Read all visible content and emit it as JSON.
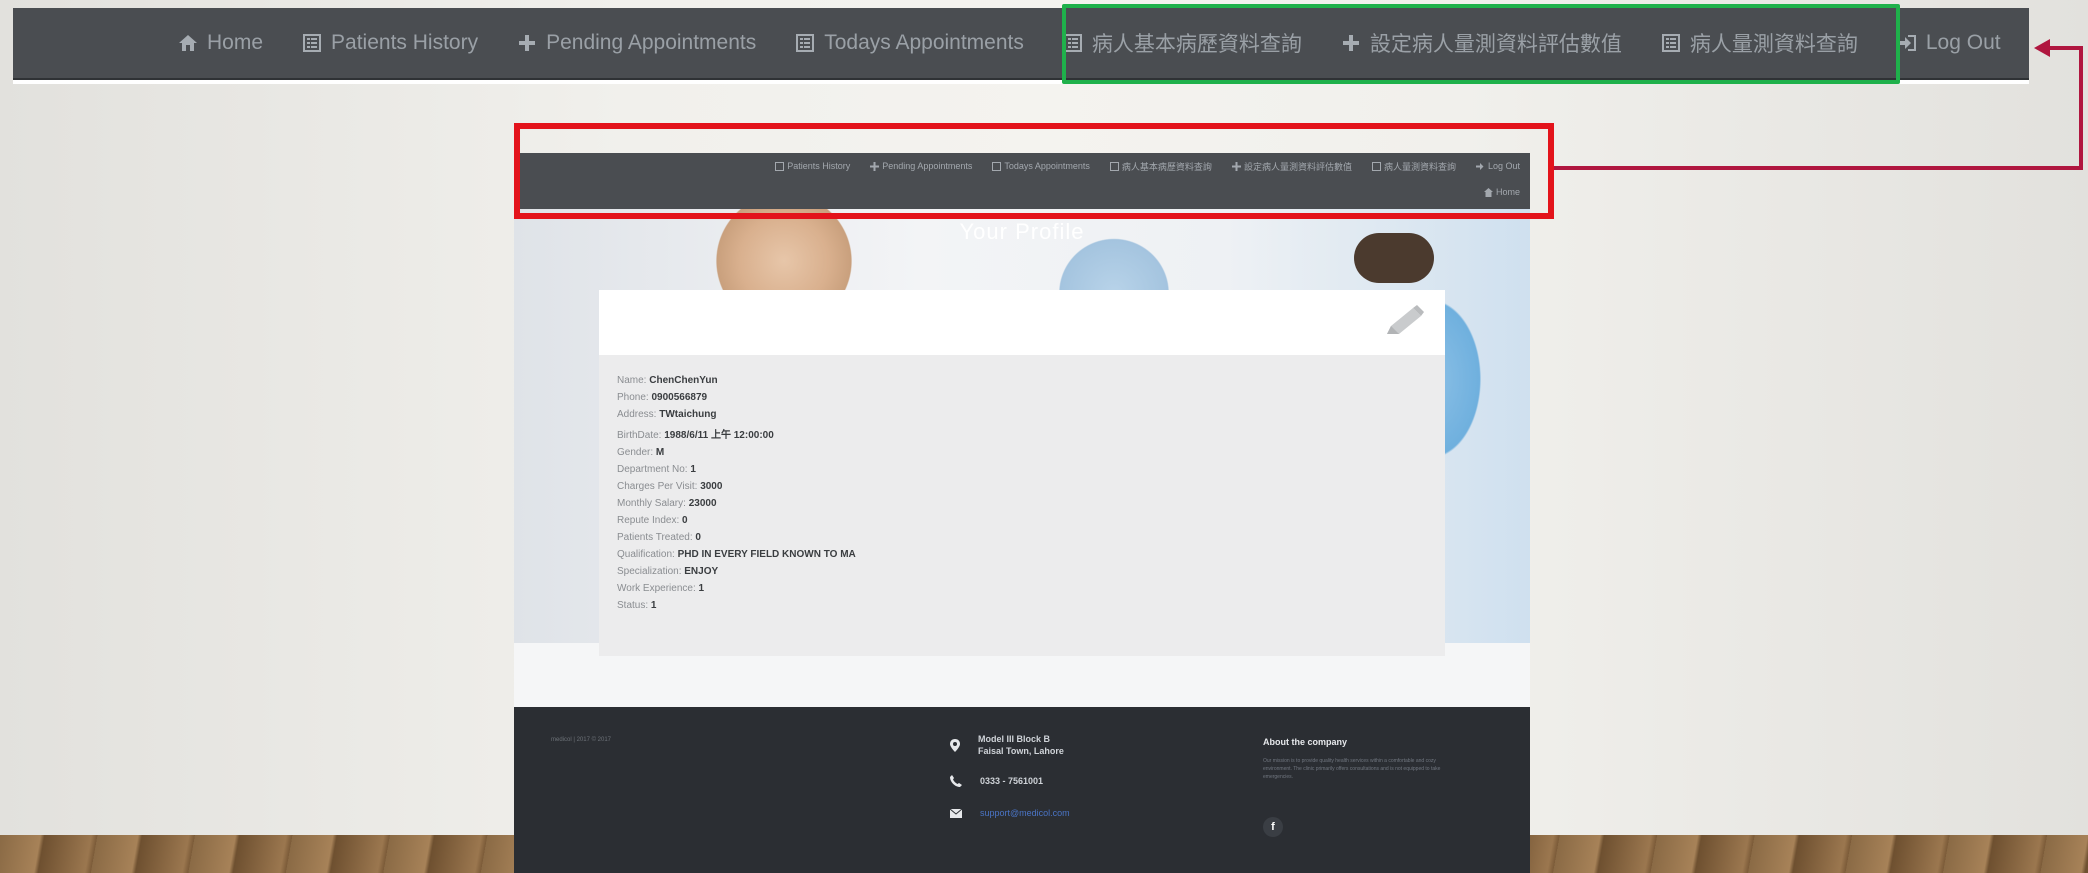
{
  "top_nav": {
    "home": "Home",
    "patients_history": "Patients History",
    "pending_appointments": "Pending Appointments",
    "todays_appointments": "Todays Appointments",
    "basic_history_query": "病人基本病歷資料查詢",
    "set_measurement_values": "設定病人量測資料評估數值",
    "measurement_query": "病人量測資料查詢",
    "logout": "Log Out"
  },
  "mini_nav": {
    "patients_history": "Patients History",
    "pending_appointments": "Pending Appointments",
    "todays_appointments": "Todays Appointments",
    "basic_history_query": "病人基本病歷資料查詢",
    "set_measurement_values": "設定病人量測資料評估數值",
    "measurement_query": "病人量測資料查詢",
    "logout": "Log Out",
    "home": "Home"
  },
  "profile": {
    "title": "Your Profile",
    "fields": [
      {
        "label": "Name:",
        "value": "ChenChenYun"
      },
      {
        "label": "Phone:",
        "value": "0900566879"
      },
      {
        "label": "Address:",
        "value": "TWtaichung"
      },
      {
        "label": "BirthDate:",
        "value": "1988/6/11 上午 12:00:00"
      },
      {
        "label": "Gender:",
        "value": "M"
      },
      {
        "label": "Department No:",
        "value": "1"
      },
      {
        "label": "Charges Per Visit:",
        "value": "3000"
      },
      {
        "label": "Monthly Salary:",
        "value": "23000"
      },
      {
        "label": "Repute Index:",
        "value": "0"
      },
      {
        "label": "Patients Treated:",
        "value": "0"
      },
      {
        "label": "Qualification:",
        "value": "PHD IN EVERY FIELD KNOWN TO MA"
      },
      {
        "label": "Specialization:",
        "value": "ENJOY"
      },
      {
        "label": "Work Experience:",
        "value": "1"
      },
      {
        "label": "Status:",
        "value": "1"
      }
    ]
  },
  "footer": {
    "copyright": "medicol | 2017 © 2017",
    "address_line1": "Model III Block B",
    "address_line2": "Faisal Town, Lahore",
    "phone": "0333 - 7561001",
    "email": "support@medicol.com",
    "about_title": "About the company",
    "about_text": "Our mission is to provide quality health services within a comfortable and cozy environment. The clinic primarily offers consultations and is not equipped to take emergencies.",
    "facebook": "f"
  },
  "colors": {
    "nav_bg": "#4a4d51",
    "highlight_green": "#1fb14b",
    "highlight_red": "#e3131b",
    "arrow": "#b0163f"
  }
}
